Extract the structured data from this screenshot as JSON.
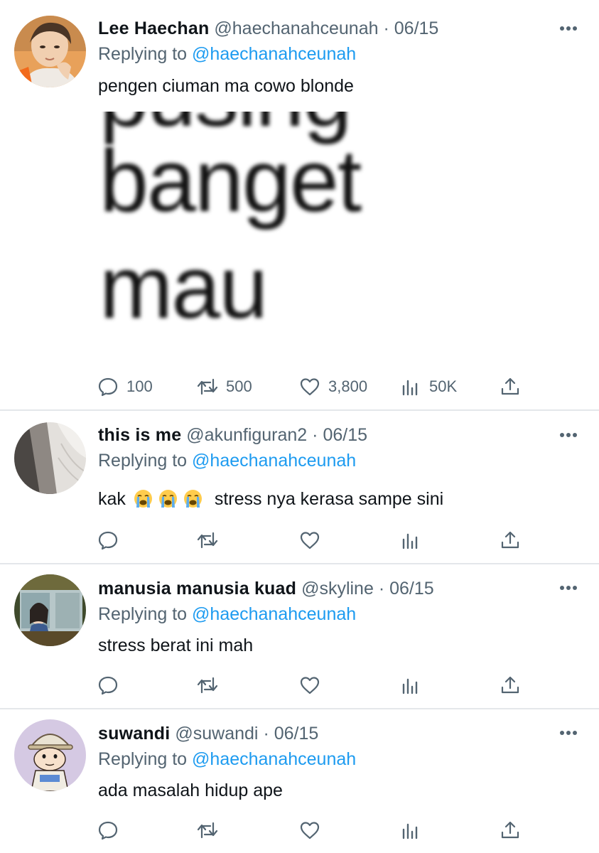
{
  "tweets": [
    {
      "display_name": "Lee Haechan",
      "handle": "@haechanahceunah",
      "date": "06/15",
      "replying_prefix": "Replying to",
      "replying_handle": "@haechanahceunah",
      "text": "pengen ciuman ma cowo blonde",
      "media_words": [
        "pusing",
        "banget",
        "mau"
      ],
      "stats": {
        "replies": "100",
        "retweets": "500",
        "likes": "3,800",
        "views": "50K"
      }
    },
    {
      "display_name": "this is me",
      "handle": "@akunfiguran2",
      "date": "06/15",
      "replying_prefix": "Replying to",
      "replying_handle": "@haechanahceunah",
      "text_prefix": "kak",
      "text_suffix": "stress nya kerasa sampe sini",
      "emojis": [
        "loudly-crying-face-emoji",
        "loudly-crying-face-emoji",
        "loudly-crying-face-emoji"
      ]
    },
    {
      "display_name": "manusia manusia kuad",
      "handle": "@skyline",
      "date": "06/15",
      "replying_prefix": "Replying to",
      "replying_handle": "@haechanahceunah",
      "text": "stress berat ini mah"
    },
    {
      "display_name": "suwandi",
      "handle": "@suwandi",
      "date": "06/15",
      "replying_prefix": "Replying to",
      "replying_handle": "@haechanahceunah",
      "text": "ada masalah hidup ape"
    }
  ],
  "icons": [
    "reply-icon",
    "retweet-icon",
    "like-icon",
    "views-icon",
    "share-icon",
    "more-icon"
  ],
  "colors": {
    "link": "#1d9bf0",
    "secondary": "#536471",
    "primary_text": "#0f1419",
    "divider": "#e4e7ea"
  }
}
